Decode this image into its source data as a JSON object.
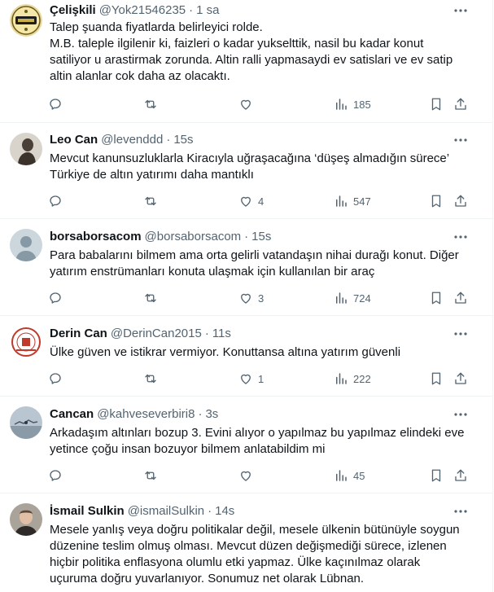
{
  "tweets": [
    {
      "name": "Çelişkili",
      "handle": "@Yok21546235",
      "time": "1 sa",
      "lines": [
        "Talep şuanda fiyatlarda belirleyici rolde.",
        "M.B. taleple ilgilenir ki, faizleri o kadar yukselttik, nasil bu kadar konut",
        "satiliyor u arastirmak zorunda. Altin ralli yapmasaydi ev satislari ve ev satip",
        "altin alanlar cok daha az olacaktı."
      ],
      "replies": "",
      "retweets": "",
      "likes": "",
      "views": "185",
      "avatar_icon": "badge-logo-icon"
    },
    {
      "name": "Leo Can",
      "handle": "@levenddd",
      "time": "15s",
      "lines": [
        "Mevcut kanunsuzluklarla Kiracıyla uğraşacağına ‘düşeş almadığın sürece’",
        "Türkiye de altın yatırımı daha mantıklı"
      ],
      "replies": "",
      "retweets": "",
      "likes": "4",
      "views": "547",
      "avatar_icon": "statue-photo-icon"
    },
    {
      "name": "borsaborsacom",
      "handle": "@borsaborsacom",
      "time": "15s",
      "lines": [
        "Para babalarını bilmem ama orta gelirli vatandaşın nihai durağı konut. Diğer",
        "yatırım enstrümanları konuta ulaşmak için kullanılan bir araç"
      ],
      "replies": "",
      "retweets": "",
      "likes": "3",
      "views": "724",
      "avatar_icon": "default-user-icon"
    },
    {
      "name": "Derin Can",
      "handle": "@DerinCan2015",
      "time": "11s",
      "lines": [
        "Ülke güven ve istikrar vermiyor. Konuttansa altına yatırım güvenli"
      ],
      "replies": "",
      "retweets": "",
      "likes": "1",
      "views": "222",
      "avatar_icon": "seal-logo-icon"
    },
    {
      "name": "Cancan",
      "handle": "@kahveseverbiri8",
      "time": "3s",
      "lines": [
        "Arkadaşım altınları bozup 3. Evini alıyor o yapılmaz bu yapılmaz elindeki eve",
        "yetince çoğu insan bozuyor bilmem anlatabildim mi"
      ],
      "replies": "",
      "retweets": "",
      "likes": "",
      "views": "45",
      "avatar_icon": "landscape-photo-icon"
    },
    {
      "name": "İsmail Sulkin",
      "handle": "@ismailSulkin",
      "time": "14s",
      "lines": [
        "Mesele yanlış veya doğru politikalar değil, mesele ülkenin bütünüyle soygun",
        "düzenine teslim olmuş olması. Mevcut düzen değişmediği sürece, izlenen",
        "hiçbir politika enflasyona olumlu etki yapmaz. Ülke kaçınılmaz olarak",
        "uçuruma doğru yuvarlanıyor. Sonumuz net olarak Lübnan."
      ],
      "replies": "",
      "retweets": "",
      "likes": "",
      "views": "",
      "avatar_icon": "person-photo-icon"
    }
  ],
  "colors": {
    "text": "#0f1419",
    "secondary": "#536471",
    "border": "#eff3f4"
  }
}
